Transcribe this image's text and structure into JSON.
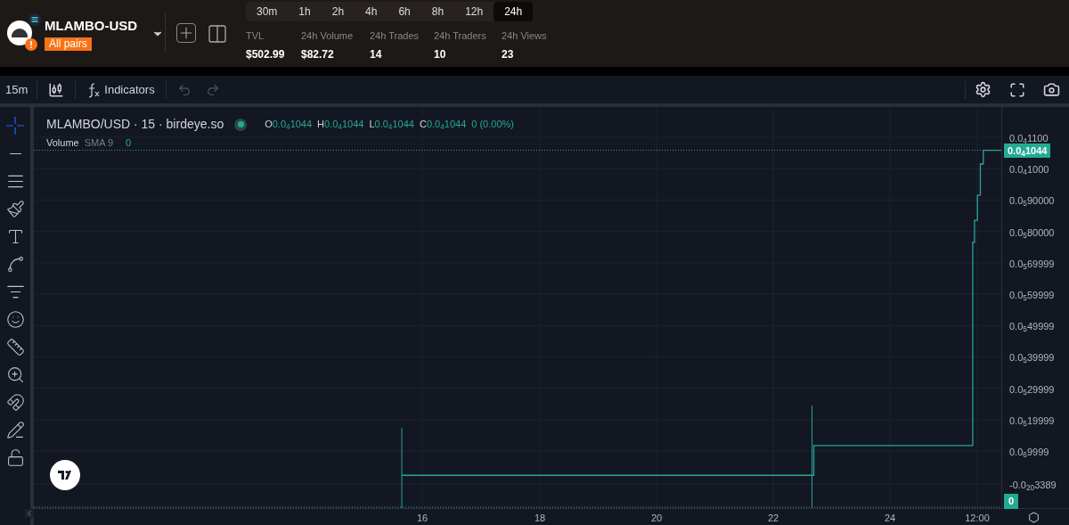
{
  "header": {
    "pair": "MLAMBO-USD",
    "badge": "All pairs",
    "timeframes": [
      {
        "label": "30m",
        "selected": false
      },
      {
        "label": "1h",
        "selected": false
      },
      {
        "label": "2h",
        "selected": false
      },
      {
        "label": "4h",
        "selected": false
      },
      {
        "label": "6h",
        "selected": false
      },
      {
        "label": "8h",
        "selected": false
      },
      {
        "label": "12h",
        "selected": false
      },
      {
        "label": "24h",
        "selected": true
      }
    ],
    "stats": [
      {
        "label": "TVL",
        "value": "$502.99"
      },
      {
        "label": "24h Volume",
        "value": "$82.72"
      },
      {
        "label": "24h Trades",
        "value": "14"
      },
      {
        "label": "24h Traders",
        "value": "10"
      },
      {
        "label": "24h Views",
        "value": "23"
      }
    ]
  },
  "toolbar": {
    "interval": "15m",
    "indicators": "Indicators"
  },
  "drawing_tools": [
    {
      "kind": "crosshair",
      "selected": true
    },
    {
      "kind": "trendline",
      "selected": false
    },
    {
      "kind": "hlines",
      "selected": false
    },
    {
      "kind": "brush",
      "selected": false
    },
    {
      "kind": "text",
      "selected": false
    },
    {
      "kind": "pattern",
      "selected": false
    },
    {
      "kind": "fib",
      "selected": false
    },
    {
      "kind": "emoji",
      "selected": false
    },
    {
      "kind": "ruler",
      "selected": false
    },
    {
      "kind": "zoom",
      "selected": false
    },
    {
      "kind": "magnet",
      "selected": false
    },
    {
      "kind": "lockdraw",
      "selected": false
    },
    {
      "kind": "lock",
      "selected": false
    }
  ],
  "legend": {
    "symbol": "MLAMBO/USD · 15 · birdeye.so",
    "ohlc": [
      {
        "label": "O",
        "value": "0.0$_{4}$1044"
      },
      {
        "label": "H",
        "value": "0.0$_{4}$1044"
      },
      {
        "label": "L",
        "value": "0.0$_{4}$1044"
      },
      {
        "label": "C",
        "value": "0.0$_{4}$1044"
      }
    ],
    "change": "0 (0.00%)",
    "volume_label": "Volume",
    "volume_study": "SMA 9",
    "volume_value": "0"
  },
  "last_price": "0.0$_{4}$1044",
  "last_volume": "0",
  "time_axis": [
    "16",
    "18",
    "20",
    "22",
    "24",
    "12:00"
  ],
  "price_axis": [
    "0.0$_{4}$1100",
    "0.0$_{4}$1000",
    "0.0$_{5}$90000",
    "0.0$_{5}$80000",
    "0.0$_{5}$69999",
    "0.0$_{5}$59999",
    "0.0$_{5}$49999",
    "0.0$_{5}$39999",
    "0.0$_{5}$29999",
    "0.0$_{5}$19999",
    "0.0$_{6}$9999",
    "-0.0$_{20}$3389"
  ]
}
